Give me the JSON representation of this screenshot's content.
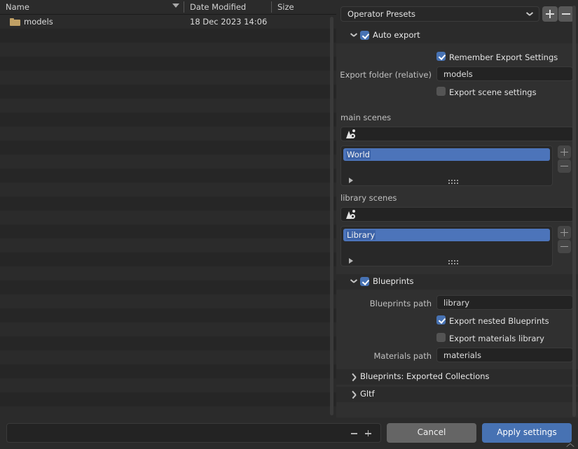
{
  "file_browser": {
    "columns": {
      "name": "Name",
      "date_modified": "Date Modified",
      "size": "Size"
    },
    "sort_indicator_icon": "sort-descending-arrow-icon",
    "rows": [
      {
        "icon": "folder-icon",
        "name": "models",
        "date_modified": "18 Dec 2023 14:06",
        "size": ""
      }
    ],
    "empty_row_count": 28
  },
  "options_panel": {
    "preset": {
      "label": "Operator Presets",
      "dropdown_icon": "chevron-down-icon",
      "add_icon": "plus-icon",
      "remove_icon": "minus-icon"
    },
    "auto_export": {
      "title": "Auto export",
      "expanded": true,
      "checked": true,
      "disclosure_icon": "chevron-down-icon",
      "remember_export_settings": {
        "label": "Remember Export Settings",
        "checked": true
      },
      "export_folder": {
        "label": "Export folder (relative)",
        "value": "models"
      },
      "export_scene_settings": {
        "label": "Export scene settings",
        "checked": false
      }
    },
    "main_scenes": {
      "label": "main scenes",
      "search_icon": "scene-picker-icon",
      "search_value": "",
      "items": [
        {
          "name": "World",
          "selected": true
        }
      ],
      "expand_icon": "triangle-right-icon",
      "grip_icon": "grip-dots-icon",
      "add_icon": "plus-icon",
      "remove_icon": "minus-icon"
    },
    "library_scenes": {
      "label": "library scenes",
      "search_icon": "scene-picker-icon",
      "search_value": "",
      "items": [
        {
          "name": "Library",
          "selected": true
        }
      ],
      "expand_icon": "triangle-right-icon",
      "grip_icon": "grip-dots-icon",
      "add_icon": "plus-icon",
      "remove_icon": "minus-icon"
    },
    "blueprints": {
      "title": "Blueprints",
      "expanded": true,
      "checked": true,
      "disclosure_icon": "chevron-down-icon",
      "blueprints_path": {
        "label": "Blueprints path",
        "value": "library"
      },
      "export_nested_blueprints": {
        "label": "Export nested Blueprints",
        "checked": true
      },
      "export_materials_library": {
        "label": "Export materials library",
        "checked": false
      },
      "materials_path": {
        "label": "Materials path",
        "value": "materials"
      }
    },
    "collapsed_sections": [
      {
        "title": "Blueprints: Exported Collections",
        "icon": "chevron-right-icon",
        "expanded": false
      },
      {
        "title": "Gltf",
        "icon": "chevron-right-icon",
        "expanded": false
      }
    ]
  },
  "bottom_bar": {
    "filename": {
      "value": "",
      "placeholder": ""
    },
    "decrement_icon": "minus-icon",
    "increment_icon": "plus-icon",
    "cancel_label": "Cancel",
    "apply_label": "Apply settings",
    "resize_corner_icon": "chevron-up-icon"
  },
  "colors": {
    "accent_blue": "#4772b3",
    "selection_blue": "#4c74ba",
    "panel_bg": "#303030",
    "band_bg": "#2b2b2b",
    "file_bg": "#282828",
    "folder_gold": "#c0a065"
  }
}
